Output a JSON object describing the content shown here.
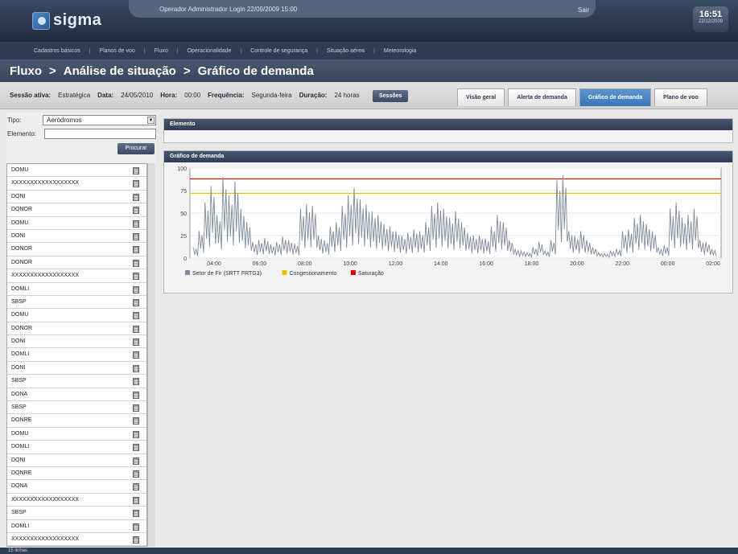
{
  "header": {
    "logo_text": "sigma",
    "user_text": "Operador Administrador Login 22/09/2009 15:00",
    "sair": "Sair",
    "clock_time": "16:51",
    "clock_date": "22/12/2009"
  },
  "menu": {
    "items": [
      "Cadastros básicos",
      "Planos de voo",
      "Fluxo",
      "Operacionalidade",
      "Controle de segurança",
      "Situação aérea",
      "Meteorologia"
    ]
  },
  "breadcrumb": {
    "items": [
      "Fluxo",
      "Análise de situação",
      "Gráfico de demanda"
    ],
    "separator": ">"
  },
  "session": {
    "sessao_label": "Sessão ativa:",
    "sessao_value": "Estratégica",
    "data_label": "Data:",
    "data_value": "24/05/2010",
    "hora_label": "Hora:",
    "hora_value": "00:00",
    "frequencia_label": "Frequência:",
    "frequencia_value": "Segunda-feira",
    "duracao_label": "Duração:",
    "duracao_value": "24 horas",
    "sessoes_button": "Sessões"
  },
  "tabs": [
    {
      "label": "Visão geral",
      "active": false
    },
    {
      "label": "Alerta de demanda",
      "active": false
    },
    {
      "label": "Gráfico de demanda",
      "active": true
    },
    {
      "label": "Plano de voo",
      "active": false
    }
  ],
  "filter": {
    "tipo_label": "Tipo:",
    "tipo_value": "Aeródromos",
    "elemento_label": "Elemento:",
    "elemento_value": "",
    "procurar_button": "Procurar"
  },
  "list": {
    "items": [
      "DOMU",
      "XXXXXXXXXXXXXXXXXX",
      "DONI",
      "DONOR",
      "DOMU",
      "DONI",
      "DONOR",
      "DONOR",
      "XXXXXXXXXXXXXXXXXX",
      "DOMLI",
      "SBSP",
      "DOMU",
      "DONOR",
      "DONI",
      "DOMLI",
      "DONI",
      "SBSP",
      "DONA",
      "SBSP",
      "DONRE",
      "DOMU",
      "DOMLI",
      "DONI",
      "DONRE",
      "DONA",
      "XXXXXXXXXXXXXXXXXX",
      "SBSP",
      "DOMLI",
      "XXXXXXXXXXXXXXXXXX"
    ]
  },
  "panels": {
    "elemento_title": "Elemento",
    "grafico_title": "Gráfico de demanda"
  },
  "footer": {
    "text": "15 linhas"
  },
  "chart_data": {
    "type": "line",
    "ylim": [
      0,
      100
    ],
    "yticks": [
      0,
      25,
      50,
      75,
      100
    ],
    "x_tick_labels": [
      "04:00",
      "06:00",
      "08:00",
      "10:00",
      "12:00",
      "14:00",
      "16:00",
      "18:00",
      "20:00",
      "22:00",
      "00:00",
      "02:00"
    ],
    "series": [
      {
        "name": "Setor de Fir (SRTT FRTG3)",
        "color": "#808a9c",
        "values": [
          12,
          30,
          62,
          80,
          48,
          90,
          70,
          85,
          55,
          40,
          18,
          20,
          22,
          15,
          18,
          24,
          20,
          16,
          55,
          60,
          58,
          25,
          20,
          35,
          40,
          58,
          70,
          78,
          65,
          60,
          52,
          48,
          38,
          35,
          30,
          25,
          28,
          32,
          30,
          40,
          58,
          62,
          55,
          45,
          52,
          40,
          28,
          25,
          25,
          22,
          35,
          48,
          40,
          20,
          10,
          8,
          6,
          12,
          18,
          8,
          20,
          88,
          92,
          30,
          25,
          30,
          20,
          12,
          6,
          5,
          8,
          10,
          30,
          32,
          45,
          48,
          38,
          30,
          12,
          14,
          55,
          62,
          45,
          48,
          55,
          20,
          18,
          10
        ]
      },
      {
        "name": "Congestionamento",
        "color": "#e8c400",
        "values": [
          72
        ]
      },
      {
        "name": "Saturação",
        "color": "#e00000",
        "values": [
          88
        ]
      }
    ]
  }
}
